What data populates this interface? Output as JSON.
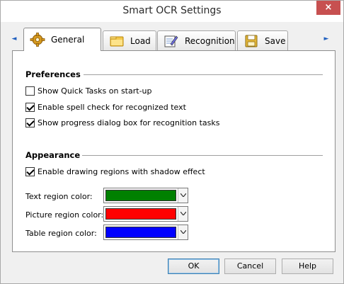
{
  "window": {
    "title": "Smart OCR Settings",
    "close_glyph": "×"
  },
  "tabs": [
    {
      "label": "General",
      "icon": "gear-icon",
      "active": true
    },
    {
      "label": "Load",
      "icon": "folder-icon",
      "active": false
    },
    {
      "label": "Recognition",
      "icon": "recognition-icon",
      "active": false
    },
    {
      "label": "Save",
      "icon": "floppy-icon",
      "active": false
    }
  ],
  "scroll": {
    "left": "◄",
    "right": "►"
  },
  "preferences": {
    "title": "Preferences",
    "options": [
      {
        "label": "Show Quick Tasks on start-up",
        "checked": false
      },
      {
        "label": "Enable spell check for recognized text",
        "checked": true
      },
      {
        "label": "Show progress dialog box for recognition tasks",
        "checked": true
      }
    ]
  },
  "appearance": {
    "title": "Appearance",
    "shadow_option": {
      "label": "Enable drawing regions with shadow effect",
      "checked": true
    },
    "colors": [
      {
        "label": "Text region color:",
        "value": "#008000"
      },
      {
        "label": "Picture region color:",
        "value": "#ff0000"
      },
      {
        "label": "Table region color:",
        "value": "#0000ff"
      }
    ]
  },
  "buttons": {
    "ok": "OK",
    "cancel": "Cancel",
    "help": "Help"
  }
}
